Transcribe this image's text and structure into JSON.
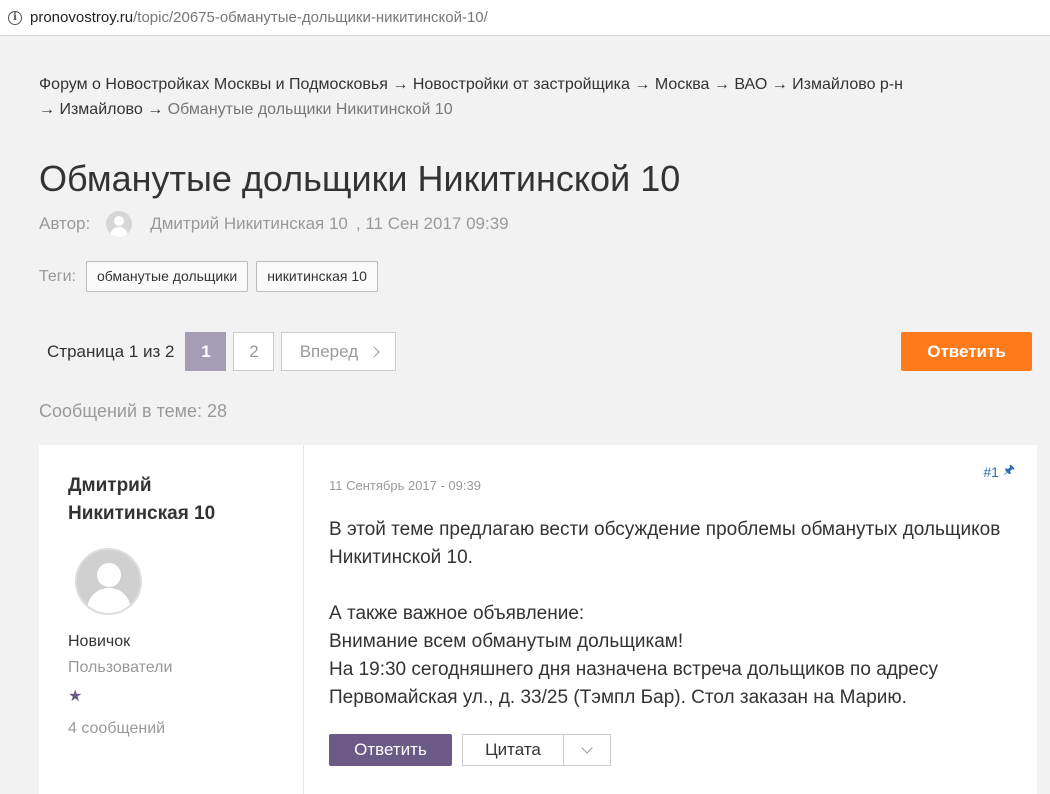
{
  "browser": {
    "url_host": "pronovostroy.ru",
    "url_path": "/topic/20675-обманутые-дольщики-никитинской-10/"
  },
  "breadcrumb": {
    "items": [
      "Форум о Новостройках Москвы и Подмосковья",
      "Новостройки от застройщика",
      "Москва",
      "ВАО",
      "Измайлово р-н",
      "Измайлово"
    ],
    "current": "Обманутые дольщики Никитинской 10",
    "separator": "→"
  },
  "topic": {
    "title": "Обманутые дольщики Никитинской 10",
    "author_label": "Автор:",
    "author": "Дмитрий Никитинская 10",
    "date": ", 11 Сен 2017 09:39",
    "tags_label": "Теги:",
    "tags": [
      "обманутые дольщики",
      "никитинская 10"
    ]
  },
  "pagination": {
    "label": "Страница 1 из 2",
    "pages": [
      "1",
      "2"
    ],
    "active": "1",
    "next_label": "Вперед"
  },
  "actions": {
    "reply_label": "Ответить"
  },
  "message_count": "Сообщений в теме: 28",
  "post": {
    "author_name": "Дмитрий Никитинская 10",
    "rank": "Новичок",
    "group": "Пользователи",
    "star": "★",
    "messages": "4 сообщений",
    "date": "11 Сентябрь 2017 - 09:39",
    "number": "#1",
    "paragraphs": [
      "В этой теме предлагаю вести обсуждение проблемы обманутых дольщиков Никитинской 10.",
      "",
      "А также важное объявление:",
      "Внимание всем обманутым дольщикам!",
      "На 19:30 сегодняшнего дня назначена встреча дольщиков по адресу Первомайская ул., д. 33/25 (Тэмпл Бар). Стол заказан на Марию."
    ],
    "reply_label": "Ответить",
    "quote_label": "Цитата"
  },
  "colors": {
    "accent_orange": "#ff7a1a",
    "accent_purple": "#6b5a85",
    "pager_active": "#a59cb5",
    "link_blue": "#2a6cb5"
  },
  "icons": [
    "info-icon",
    "avatar-icon",
    "chevron-right-icon",
    "pin-icon",
    "chevron-down-icon",
    "star-icon"
  ]
}
